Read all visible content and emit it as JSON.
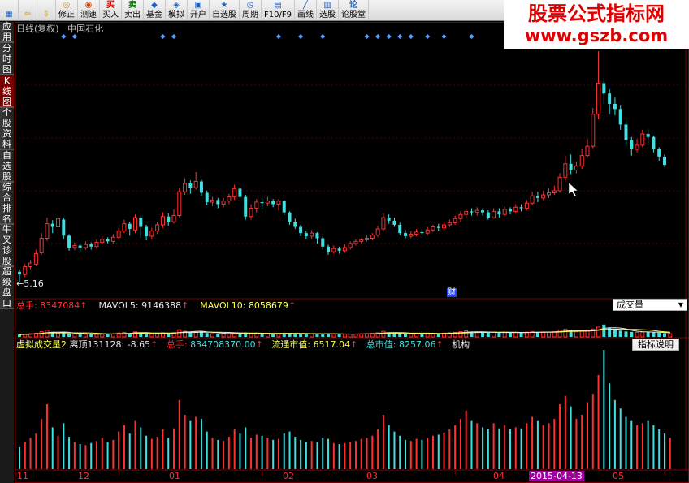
{
  "toolbar": {
    "buttons": [
      {
        "label": "",
        "icon": "grid-icon"
      },
      {
        "label": "",
        "icon": "back-arrow-icon"
      },
      {
        "label": "",
        "icon": "down-arrow-icon"
      },
      {
        "label": "修正",
        "icon": "fix-icon"
      },
      {
        "label": "测速",
        "icon": "speed-icon"
      },
      {
        "label": "买入",
        "icon": "buy-icon"
      },
      {
        "label": "卖出",
        "icon": "sell-icon"
      },
      {
        "label": "基金",
        "icon": "fund-icon"
      },
      {
        "label": "模拟",
        "icon": "simulate-icon"
      },
      {
        "label": "开户",
        "icon": "open-account-icon"
      },
      {
        "label": "自选股",
        "icon": "favorites-icon"
      },
      {
        "label": "周期",
        "icon": "period-icon"
      },
      {
        "label": "F10/F9",
        "icon": "f10-icon"
      },
      {
        "label": "画线",
        "icon": "draw-line-icon"
      },
      {
        "label": "选股",
        "icon": "select-stock-icon"
      },
      {
        "label": "论股堂",
        "icon": "forum-icon"
      }
    ]
  },
  "watermark": {
    "line1": "股票公式指标网",
    "line2": "www.gszb.com"
  },
  "sidebar": {
    "tabs": [
      {
        "label": "应用",
        "active": false
      },
      {
        "label": "分时图",
        "active": false
      },
      {
        "label": "K线图",
        "active": true
      },
      {
        "label": "个股资料",
        "active": false
      },
      {
        "label": "自选股",
        "active": false
      },
      {
        "label": "综合排名",
        "active": false
      },
      {
        "label": "牛叉诊股",
        "active": false
      },
      {
        "label": "超级盘口",
        "active": false
      }
    ]
  },
  "main_panel": {
    "title": "日线(复权)",
    "stock_name": "中国石化",
    "low_label": "5.16"
  },
  "volume_panel": {
    "total_label": "总手:",
    "total_value": "8347084",
    "mavol5_label": "MAVOL5:",
    "mavol5_value": "9146388",
    "mavol10_label": "MAVOL10:",
    "mavol10_value": "8058679",
    "dropdown_value": "成交量"
  },
  "indicator_panel": {
    "name": "虚拟成交量2",
    "distance_label": "离顶131128:",
    "distance_value": "-8.65",
    "total_label": "总手:",
    "total_value": "834708370.00",
    "float_cap_label": "流通市值:",
    "float_cap_value": "6517.04",
    "total_cap_label": "总市值:",
    "total_cap_value": "8257.06",
    "extra_label": "机构",
    "explain_button": "指标说明"
  },
  "cai_label": "财",
  "x_axis": {
    "month_labels": [
      "11",
      "12",
      "01",
      "02",
      "03",
      "04",
      "05"
    ],
    "selected_date": "2015-04-13"
  },
  "colors": {
    "up": "#ff3030",
    "down": "#40e0e0",
    "signal": "#5aa0ff",
    "grid": "#800000"
  },
  "chart_data": {
    "type": "candlestick",
    "candles": [
      [
        5.35,
        5.3,
        5.4,
        5.16
      ],
      [
        5.3,
        5.45,
        5.5,
        5.25
      ],
      [
        5.45,
        5.52,
        5.58,
        5.4
      ],
      [
        5.5,
        5.7,
        5.78,
        5.46
      ],
      [
        5.72,
        6.0,
        6.1,
        5.68
      ],
      [
        6.0,
        6.28,
        6.4,
        5.95
      ],
      [
        6.28,
        6.22,
        6.35,
        6.1
      ],
      [
        6.22,
        6.38,
        6.46,
        6.15
      ],
      [
        6.36,
        6.05,
        6.4,
        5.98
      ],
      [
        6.05,
        5.82,
        6.08,
        5.76
      ],
      [
        5.82,
        5.86,
        5.92,
        5.77
      ],
      [
        5.86,
        5.82,
        5.9,
        5.75
      ],
      [
        5.82,
        5.88,
        5.94,
        5.78
      ],
      [
        5.88,
        5.84,
        5.92,
        5.78
      ],
      [
        5.84,
        5.92,
        5.98,
        5.8
      ],
      [
        5.92,
        5.98,
        6.04,
        5.88
      ],
      [
        5.98,
        5.94,
        6.02,
        5.9
      ],
      [
        5.94,
        6.02,
        6.08,
        5.9
      ],
      [
        6.02,
        6.14,
        6.2,
        5.98
      ],
      [
        6.14,
        6.28,
        6.36,
        6.1
      ],
      [
        6.28,
        6.18,
        6.32,
        6.05
      ],
      [
        6.16,
        6.4,
        6.46,
        6.1
      ],
      [
        6.4,
        6.22,
        6.44,
        6.0
      ],
      [
        6.22,
        6.04,
        6.26,
        5.96
      ],
      [
        6.04,
        6.14,
        6.2,
        5.98
      ],
      [
        6.14,
        6.26,
        6.32,
        6.08
      ],
      [
        6.26,
        6.42,
        6.5,
        6.2
      ],
      [
        6.42,
        6.32,
        6.48,
        6.24
      ],
      [
        6.32,
        6.44,
        6.56,
        6.28
      ],
      [
        6.44,
        6.9,
        6.98,
        6.4
      ],
      [
        6.9,
        7.06,
        7.16,
        6.84
      ],
      [
        7.06,
        6.98,
        7.12,
        6.86
      ],
      [
        6.98,
        7.1,
        7.28,
        6.94
      ],
      [
        7.1,
        6.88,
        7.14,
        6.82
      ],
      [
        6.88,
        6.7,
        6.92,
        6.64
      ],
      [
        6.7,
        6.74,
        6.8,
        6.62
      ],
      [
        6.74,
        6.66,
        6.78,
        6.58
      ],
      [
        6.66,
        6.72,
        6.78,
        6.6
      ],
      [
        6.72,
        6.8,
        6.86,
        6.66
      ],
      [
        6.8,
        6.96,
        7.04,
        6.74
      ],
      [
        6.96,
        6.8,
        7.0,
        6.72
      ],
      [
        6.8,
        6.42,
        6.84,
        6.36
      ],
      [
        6.42,
        6.58,
        6.66,
        6.36
      ],
      [
        6.58,
        6.7,
        6.76,
        6.5
      ],
      [
        6.7,
        6.68,
        6.78,
        6.56
      ],
      [
        6.68,
        6.72,
        6.8,
        6.62
      ],
      [
        6.72,
        6.66,
        6.76,
        6.6
      ],
      [
        6.66,
        6.72,
        6.76,
        6.54
      ],
      [
        6.72,
        6.5,
        6.74,
        6.44
      ],
      [
        6.5,
        6.32,
        6.52,
        6.26
      ],
      [
        6.32,
        6.22,
        6.38,
        6.18
      ],
      [
        6.22,
        6.1,
        6.26,
        6.04
      ],
      [
        6.1,
        6.04,
        6.14,
        5.98
      ],
      [
        6.04,
        6.1,
        6.16,
        5.98
      ],
      [
        6.1,
        6.0,
        6.12,
        5.9
      ],
      [
        6.0,
        5.84,
        6.04,
        5.78
      ],
      [
        5.84,
        5.74,
        5.88,
        5.68
      ],
      [
        5.74,
        5.8,
        5.86,
        5.7
      ],
      [
        5.8,
        5.76,
        5.84,
        5.7
      ],
      [
        5.76,
        5.82,
        5.88,
        5.72
      ],
      [
        5.82,
        5.9,
        5.94,
        5.78
      ],
      [
        5.9,
        5.94,
        5.98,
        5.86
      ],
      [
        5.94,
        5.97,
        6.0,
        5.9
      ],
      [
        5.97,
        6.0,
        6.06,
        5.94
      ],
      [
        6.0,
        6.06,
        6.1,
        5.96
      ],
      [
        6.06,
        6.18,
        6.24,
        6.02
      ],
      [
        6.18,
        6.4,
        6.48,
        6.14
      ],
      [
        6.4,
        6.34,
        6.46,
        6.28
      ],
      [
        6.34,
        6.26,
        6.4,
        6.22
      ],
      [
        6.26,
        6.1,
        6.3,
        6.06
      ],
      [
        6.1,
        6.04,
        6.16,
        6.0
      ],
      [
        6.04,
        6.08,
        6.14,
        6.0
      ],
      [
        6.08,
        6.12,
        6.18,
        6.04
      ],
      [
        6.12,
        6.1,
        6.18,
        6.06
      ],
      [
        6.1,
        6.16,
        6.22,
        6.06
      ],
      [
        6.16,
        6.22,
        6.26,
        6.12
      ],
      [
        6.22,
        6.2,
        6.28,
        6.14
      ],
      [
        6.2,
        6.26,
        6.32,
        6.16
      ],
      [
        6.26,
        6.3,
        6.36,
        6.22
      ],
      [
        6.3,
        6.38,
        6.44,
        6.26
      ],
      [
        6.38,
        6.46,
        6.52,
        6.32
      ],
      [
        6.46,
        6.52,
        6.58,
        6.4
      ],
      [
        6.52,
        6.5,
        6.58,
        6.44
      ],
      [
        6.5,
        6.54,
        6.6,
        6.44
      ],
      [
        6.54,
        6.5,
        6.58,
        6.44
      ],
      [
        6.5,
        6.4,
        6.54,
        6.36
      ],
      [
        6.4,
        6.52,
        6.58,
        6.38
      ],
      [
        6.52,
        6.46,
        6.58,
        6.4
      ],
      [
        6.46,
        6.56,
        6.62,
        6.42
      ],
      [
        6.56,
        6.52,
        6.6,
        6.46
      ],
      [
        6.52,
        6.6,
        6.66,
        6.48
      ],
      [
        6.6,
        6.58,
        6.66,
        6.52
      ],
      [
        6.58,
        6.68,
        6.74,
        6.54
      ],
      [
        6.68,
        6.82,
        6.9,
        6.64
      ],
      [
        6.82,
        6.78,
        6.9,
        6.7
      ],
      [
        6.78,
        6.84,
        6.92,
        6.74
      ],
      [
        6.84,
        6.88,
        6.96,
        6.78
      ],
      [
        6.88,
        6.92,
        7.02,
        6.84
      ],
      [
        6.92,
        7.18,
        7.26,
        6.88
      ],
      [
        7.18,
        7.44,
        7.6,
        7.1
      ],
      [
        7.44,
        7.32,
        7.62,
        7.24
      ],
      [
        7.32,
        7.4,
        7.48,
        7.26
      ],
      [
        7.4,
        7.6,
        7.72,
        7.34
      ],
      [
        7.6,
        7.78,
        7.92,
        7.56
      ],
      [
        7.78,
        8.4,
        8.52,
        7.74
      ],
      [
        8.4,
        9.0,
        9.62,
        8.3
      ],
      [
        9.0,
        8.8,
        9.1,
        8.6
      ],
      [
        8.8,
        8.6,
        8.88,
        8.4
      ],
      [
        8.6,
        8.5,
        8.72,
        8.38
      ],
      [
        8.5,
        8.2,
        8.58,
        8.1
      ],
      [
        8.2,
        7.9,
        8.28,
        7.78
      ],
      [
        7.9,
        7.72,
        7.96,
        7.6
      ],
      [
        7.72,
        7.8,
        7.92,
        7.66
      ],
      [
        7.8,
        8.02,
        8.1,
        7.76
      ],
      [
        8.02,
        7.96,
        8.1,
        7.8
      ],
      [
        7.96,
        7.72,
        7.98,
        7.66
      ],
      [
        7.72,
        7.58,
        7.76,
        7.5
      ],
      [
        7.58,
        7.42,
        7.62,
        7.38
      ]
    ],
    "volume": [
      2.1,
      2.6,
      3.0,
      3.4,
      4.8,
      6.2,
      4.0,
      3.2,
      4.4,
      3.1,
      2.6,
      2.4,
      2.3,
      2.5,
      2.7,
      3.0,
      2.6,
      2.8,
      3.6,
      4.2,
      3.4,
      4.6,
      4.0,
      3.2,
      2.9,
      3.1,
      3.8,
      3.0,
      3.9,
      6.6,
      5.2,
      4.6,
      5.0,
      4.8,
      3.6,
      3.0,
      2.8,
      2.7,
      3.1,
      3.8,
      3.4,
      4.0,
      3.0,
      3.3,
      3.2,
      3.0,
      2.8,
      2.9,
      3.4,
      3.6,
      3.1,
      2.8,
      2.6,
      2.7,
      2.6,
      3.0,
      2.9,
      2.5,
      2.4,
      2.5,
      2.6,
      2.7,
      2.9,
      3.0,
      3.2,
      3.8,
      5.2,
      4.2,
      3.6,
      3.2,
      2.8,
      2.7,
      2.9,
      2.8,
      3.0,
      3.2,
      3.3,
      3.5,
      3.8,
      4.2,
      4.8,
      5.6,
      4.6,
      4.4,
      4.0,
      3.8,
      4.4,
      3.9,
      4.2,
      3.8,
      4.0,
      3.9,
      4.4,
      5.0,
      4.6,
      4.2,
      4.4,
      4.8,
      6.2,
      7.0,
      6.0,
      4.8,
      5.2,
      6.4,
      7.2,
      9.0,
      11.4,
      8.2,
      6.6,
      5.8,
      5.0,
      4.6,
      4.2,
      4.4,
      4.6,
      4.2,
      3.8,
      3.4,
      3.0
    ],
    "signal_markers_x": [
      8,
      10,
      26,
      28,
      47,
      51,
      55,
      63,
      65,
      67,
      69,
      71,
      74,
      77,
      82,
      105,
      109,
      126,
      128,
      130,
      141
    ]
  }
}
